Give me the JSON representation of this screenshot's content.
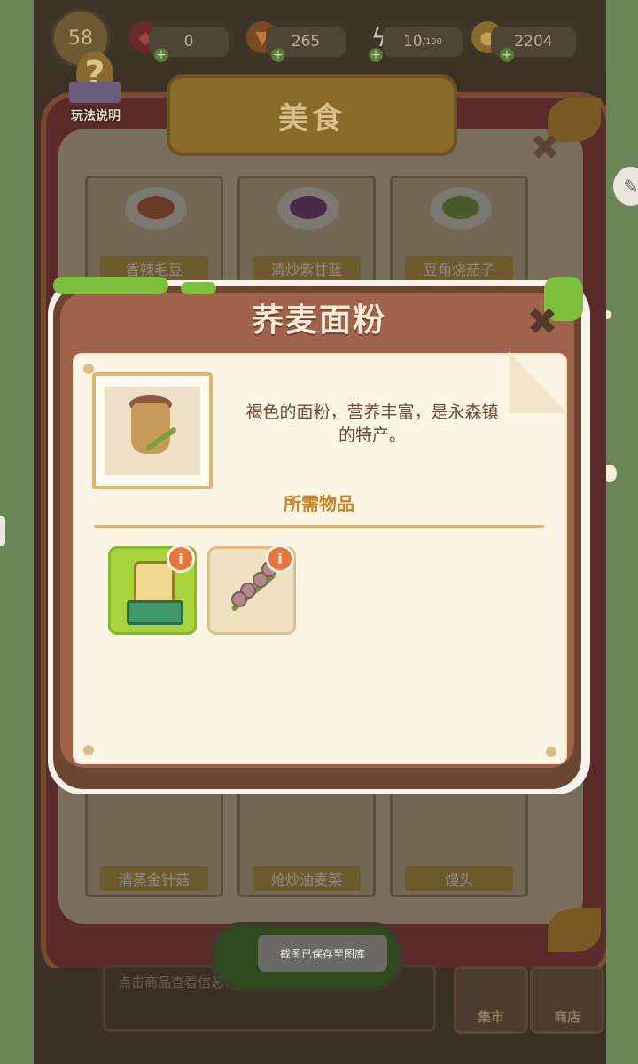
{
  "top_bar": {
    "level": "58",
    "gems": "0",
    "carrots": "265",
    "energy": "10",
    "energy_suffix": "/100",
    "coins": "2204"
  },
  "help": {
    "label": "玩法说明"
  },
  "food_window": {
    "title": "美食",
    "dishes_top": [
      "香辣毛豆",
      "清炒紫甘蓝",
      "豆角烧茄子"
    ],
    "dishes_bottom": [
      "清蒸金针菇",
      "炝炒油麦菜",
      "馒头"
    ],
    "hint": "点击商品查看信息",
    "shop_buttons": [
      "集市",
      "商店"
    ]
  },
  "popup": {
    "title": "荞麦面粉",
    "description_line1": "褐色的面粉，营养丰富，是永森镇",
    "description_line2": "的特产。",
    "required_title": "所需物品",
    "info_label": "i"
  },
  "toast": {
    "text": "截图已保存至图库"
  },
  "colors": {
    "accent_green": "#a6d43a",
    "title_brown": "#a0624a",
    "required_orange": "#c98422"
  }
}
